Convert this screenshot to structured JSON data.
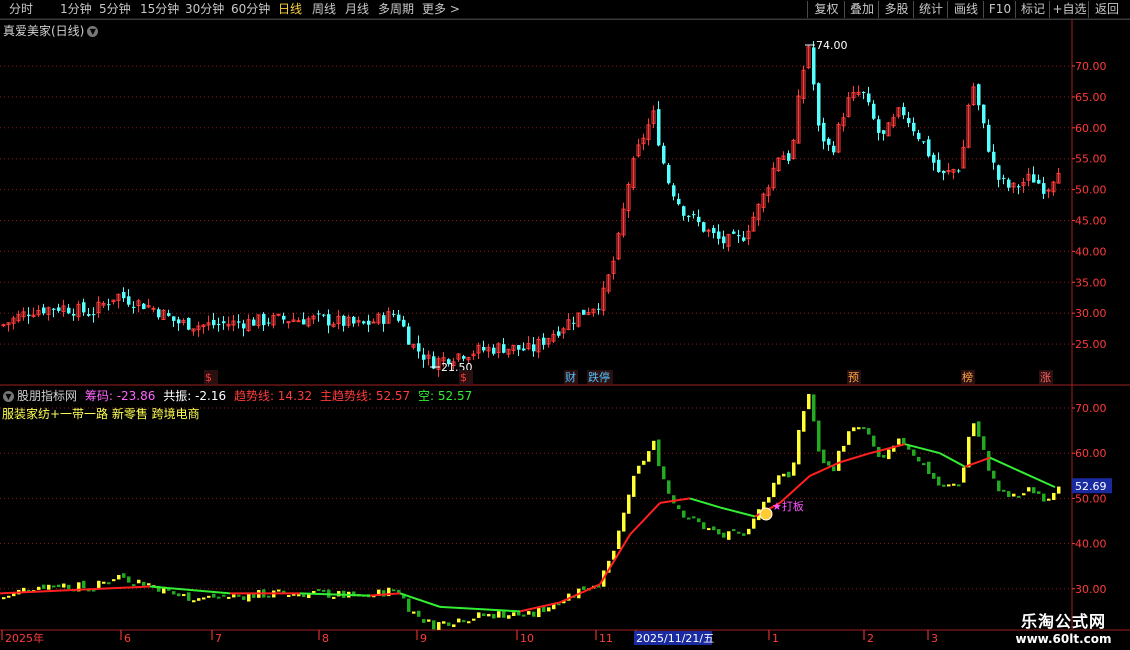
{
  "toolbar": {
    "periods": [
      "分时",
      "1分钟",
      "5分钟",
      "15分钟",
      "30分钟",
      "60分钟",
      "日线",
      "周线",
      "月线",
      "多周期",
      "更多 >"
    ],
    "active_period": "日线",
    "buttons": [
      "复权",
      "叠加",
      "多股",
      "统计",
      "画线",
      "F10",
      "标记",
      "+自选",
      "返回"
    ]
  },
  "main_chart": {
    "title": "真爱美家(日线)",
    "high_label": "74.00",
    "low_label": "21.50",
    "y_ticks": [
      "70.00",
      "65.00",
      "60.00",
      "55.00",
      "50.00",
      "45.00",
      "40.00",
      "35.00",
      "30.00",
      "25.00"
    ],
    "event_markers": [
      {
        "text": "$",
        "color": "#ff3b3b"
      },
      {
        "text": "$",
        "color": "#ff3b3b"
      },
      {
        "text": "财",
        "color": "#4fc3ff"
      },
      {
        "text": "跌停",
        "color": "#4fc3ff"
      },
      {
        "text": "预",
        "color": "#ffa640"
      },
      {
        "text": "榜",
        "color": "#ffa640"
      },
      {
        "text": "涨",
        "color": "#ff6060"
      }
    ]
  },
  "indicator": {
    "name": "股朋指标网",
    "items": [
      {
        "label": "筹码:",
        "value": "-23.86",
        "color": "#ff66ff"
      },
      {
        "label": "共振:",
        "value": "-2.16",
        "color": "#ffffff"
      },
      {
        "label": "趋势线:",
        "value": "14.32",
        "color": "#ff3b3b"
      },
      {
        "label": "主趋势线:",
        "value": "52.57",
        "color": "#ff3b3b"
      },
      {
        "label": "空:",
        "value": "52.57",
        "color": "#33ee33"
      }
    ],
    "concepts": "服装家纺+一带一路 新零售 跨境电商",
    "y_ticks": [
      "70.00",
      "60.00",
      "50.00",
      "40.00",
      "30.00"
    ],
    "current_price": "52.69",
    "signal_label": "★打板"
  },
  "date_axis": [
    "2025年",
    "6",
    "7",
    "8",
    "9",
    "10",
    "11",
    "2025/11/21/五",
    "1",
    "2",
    "3"
  ],
  "watermark": {
    "line1": "乐淘公式网",
    "line2": "www.60lt.com"
  },
  "colors": {
    "up": "#ff3b3b",
    "down": "#54ffff",
    "grid": "#8a1a1a",
    "ind_up": "#ffff33",
    "ind_down": "#22aa22",
    "trend_red": "#ff2020",
    "trend_green": "#33ee33"
  }
}
